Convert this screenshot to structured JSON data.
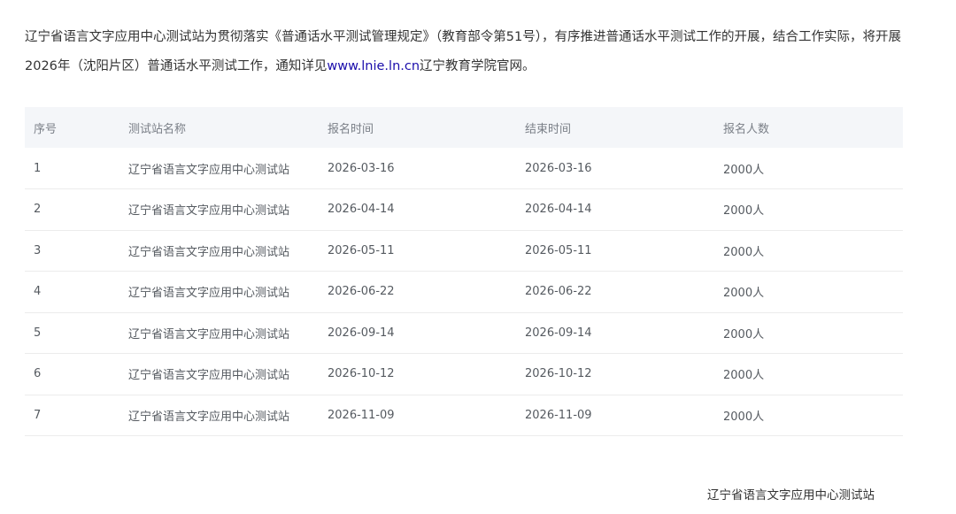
{
  "intro": {
    "text_before_link": "辽宁省语言文字应用中心测试站为贯彻落实《普通话水平测试管理规定》（教育部令第51号），有序推进普通话水平测试工作的开展，结合工作实际，将开展2026年（沈阳片区）普通话水平测试工作，通知详见",
    "link_text": "www.lnie.ln.cn",
    "text_after_link": "辽宁教育学院官网。"
  },
  "table": {
    "headers": [
      "序号",
      "测试站名称",
      "报名时间",
      "结束时间",
      "报名人数"
    ],
    "rows": [
      {
        "no": "1",
        "station": "辽宁省语言文字应用中心测试站",
        "start": "2026-03-16",
        "end": "2026-03-16",
        "count": "2000人"
      },
      {
        "no": "2",
        "station": "辽宁省语言文字应用中心测试站",
        "start": "2026-04-14",
        "end": "2026-04-14",
        "count": "2000人"
      },
      {
        "no": "3",
        "station": "辽宁省语言文字应用中心测试站",
        "start": "2026-05-11",
        "end": "2026-05-11",
        "count": "2000人"
      },
      {
        "no": "4",
        "station": "辽宁省语言文字应用中心测试站",
        "start": "2026-06-22",
        "end": "2026-06-22",
        "count": "2000人"
      },
      {
        "no": "5",
        "station": "辽宁省语言文字应用中心测试站",
        "start": "2026-09-14",
        "end": "2026-09-14",
        "count": "2000人"
      },
      {
        "no": "6",
        "station": "辽宁省语言文字应用中心测试站",
        "start": "2026-10-12",
        "end": "2026-10-12",
        "count": "2000人"
      },
      {
        "no": "7",
        "station": "辽宁省语言文字应用中心测试站",
        "start": "2026-11-09",
        "end": "2026-11-09",
        "count": "2000人"
      }
    ]
  },
  "signature": "辽宁省语言文字应用中心测试站",
  "colors": {
    "link": "#1a0dab",
    "header_bg": "#f4f6f9",
    "row_border": "#ececec"
  }
}
